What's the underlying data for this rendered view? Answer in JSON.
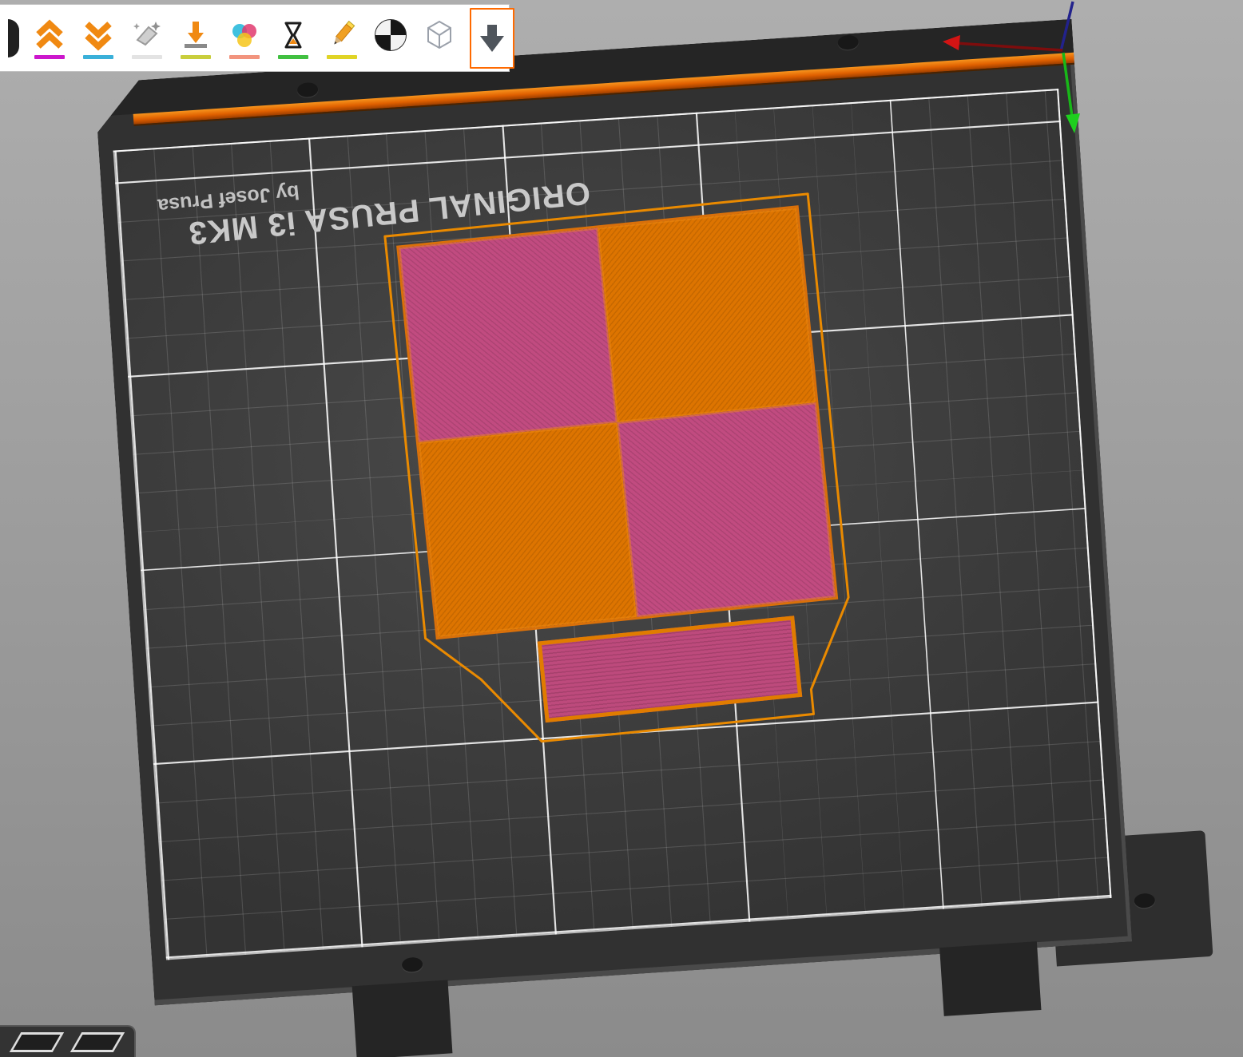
{
  "viewport": {
    "background_top": "#aeaeae",
    "background_bottom": "#8b8b8b",
    "axes": {
      "x_color": "#d31414",
      "y_color": "#1ecf1e",
      "z_color": "#2a2ab0"
    }
  },
  "toolbar": {
    "selected_index": 9,
    "selection_border_color": "#ff6a00",
    "items": [
      {
        "name": "double-chevron-up",
        "underline_color": "#cc17cc"
      },
      {
        "name": "double-chevron-down",
        "underline_color": "#3ab0d9"
      },
      {
        "name": "sparkle-eraser",
        "underline_color": "#e3e3e3"
      },
      {
        "name": "place-arrow",
        "underline_color": "#c9ce3d"
      },
      {
        "name": "color-palette",
        "underline_color": "#f2947e"
      },
      {
        "name": "hourglass",
        "underline_color": "#41c041"
      },
      {
        "name": "pencil",
        "underline_color": "#e0d426"
      },
      {
        "name": "checkered-sphere",
        "underline_color": null
      },
      {
        "name": "wireframe-cube",
        "underline_color": null
      },
      {
        "name": "import-down-arrow",
        "underline_color": null,
        "selected": true
      }
    ]
  },
  "bed": {
    "title": "ORIGINAL PRUSA i3 MK3",
    "byline": "by Josef Prusa",
    "accent_strip_color": "#e86a00",
    "surface_color": "#3b3b3b",
    "grid_major_color": "rgba(255,255,255,0.85)",
    "grid_minor_color": "rgba(255,255,255,0.14)"
  },
  "objects": {
    "checkerboard": {
      "rows": 2,
      "cols": 2,
      "tile_colors": [
        [
          "#c14b80",
          "#dd7400"
        ],
        [
          "#dd7400",
          "#c14b80"
        ]
      ]
    },
    "bar": {
      "fill_color": "#bd4a7c",
      "outline_color": "#e07c00"
    },
    "skirt_color": "#ea8a00"
  },
  "view_toggles": {
    "count": 2
  }
}
